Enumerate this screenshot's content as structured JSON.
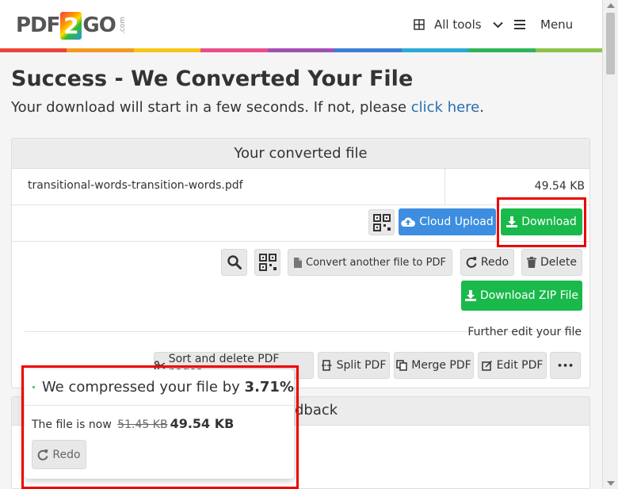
{
  "header": {
    "logo": {
      "part1": "PDF",
      "part2": "2",
      "part3": "GO",
      "suffix": ".com"
    },
    "all_tools_label": "All tools",
    "menu_label": "Menu",
    "rainbow_colors": [
      "#e8443a",
      "#f39a1f",
      "#f6c518",
      "#e94d8a",
      "#a14fb5",
      "#3a7fd5",
      "#2aa9d5",
      "#2fb45a",
      "#8bc34a"
    ]
  },
  "page": {
    "title": "Success - We Converted Your File",
    "subtitle_text": "Your download will start in a few seconds. If not, please ",
    "subtitle_link": "click here",
    "subtitle_end": "."
  },
  "converted": {
    "heading": "Your converted file",
    "file_name": "transitional-words-transition-words.pdf",
    "file_size": "49.54 KB",
    "cloud_upload_label": "Cloud Upload",
    "download_label": "Download",
    "convert_another_label": "Convert another file to PDF",
    "redo_label": "Redo",
    "delete_label": "Delete",
    "download_zip_label": "Download ZIP File",
    "further_edit_label": "Further edit your file",
    "tools": {
      "sort_delete_label": "Sort and delete PDF pages",
      "split_label": "Split PDF",
      "merge_label": "Merge PDF",
      "edit_label": "Edit PDF",
      "more_label": "•••"
    }
  },
  "feedback": {
    "title_visible": "dback"
  },
  "toast": {
    "message": "We compressed your file by ",
    "percent": "3.71%",
    "now_label": "The file is now ",
    "old_size": "51.45 KB",
    "new_size": "49.54 KB",
    "redo_label": "Redo"
  },
  "colors": {
    "accent_green": "#19b94b",
    "accent_blue": "#3d8ee0",
    "link": "#2a6db0",
    "highlight_red": "#e00000"
  }
}
